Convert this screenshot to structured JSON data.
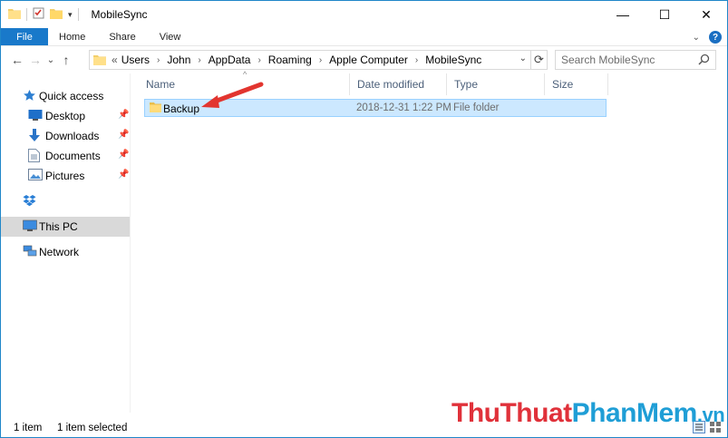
{
  "window": {
    "title": "MobileSync",
    "accent": "#1979ca"
  },
  "title_controls": {
    "minimize": "—",
    "maximize": "☐",
    "close": "✕"
  },
  "ribbon": {
    "tabs": [
      "File",
      "Home",
      "Share",
      "View"
    ],
    "expand_icon": "chevron-down-icon",
    "help": "?"
  },
  "nav": {
    "back": "←",
    "forward": "→",
    "recent": "⌄",
    "up": "↑"
  },
  "address": {
    "overflow": "«",
    "crumbs": [
      "Users",
      "John",
      "AppData",
      "Roaming",
      "Apple Computer",
      "MobileSync"
    ]
  },
  "search": {
    "placeholder": "Search MobileSync"
  },
  "sidebar": {
    "quick_access": "Quick access",
    "items": [
      {
        "label": "Desktop",
        "icon": "desktop-icon",
        "pinned": true
      },
      {
        "label": "Downloads",
        "icon": "downloads-icon",
        "pinned": true
      },
      {
        "label": "Documents",
        "icon": "documents-icon",
        "pinned": true
      },
      {
        "label": "Pictures",
        "icon": "pictures-icon",
        "pinned": true
      }
    ],
    "dropbox_icon": "dropbox-icon",
    "this_pc": "This PC",
    "network": "Network"
  },
  "columns": {
    "name": "Name",
    "date": "Date modified",
    "type": "Type",
    "size": "Size"
  },
  "files": [
    {
      "name": "Backup",
      "date": "2018-12-31 1:22 PM",
      "type": "File folder",
      "size": ""
    }
  ],
  "status": {
    "count": "1 item",
    "selected": "1 item selected"
  },
  "watermark": {
    "part1": "Thu",
    "part2": "Thuat",
    "part3": "PhanMem",
    "part4": ".vn"
  }
}
